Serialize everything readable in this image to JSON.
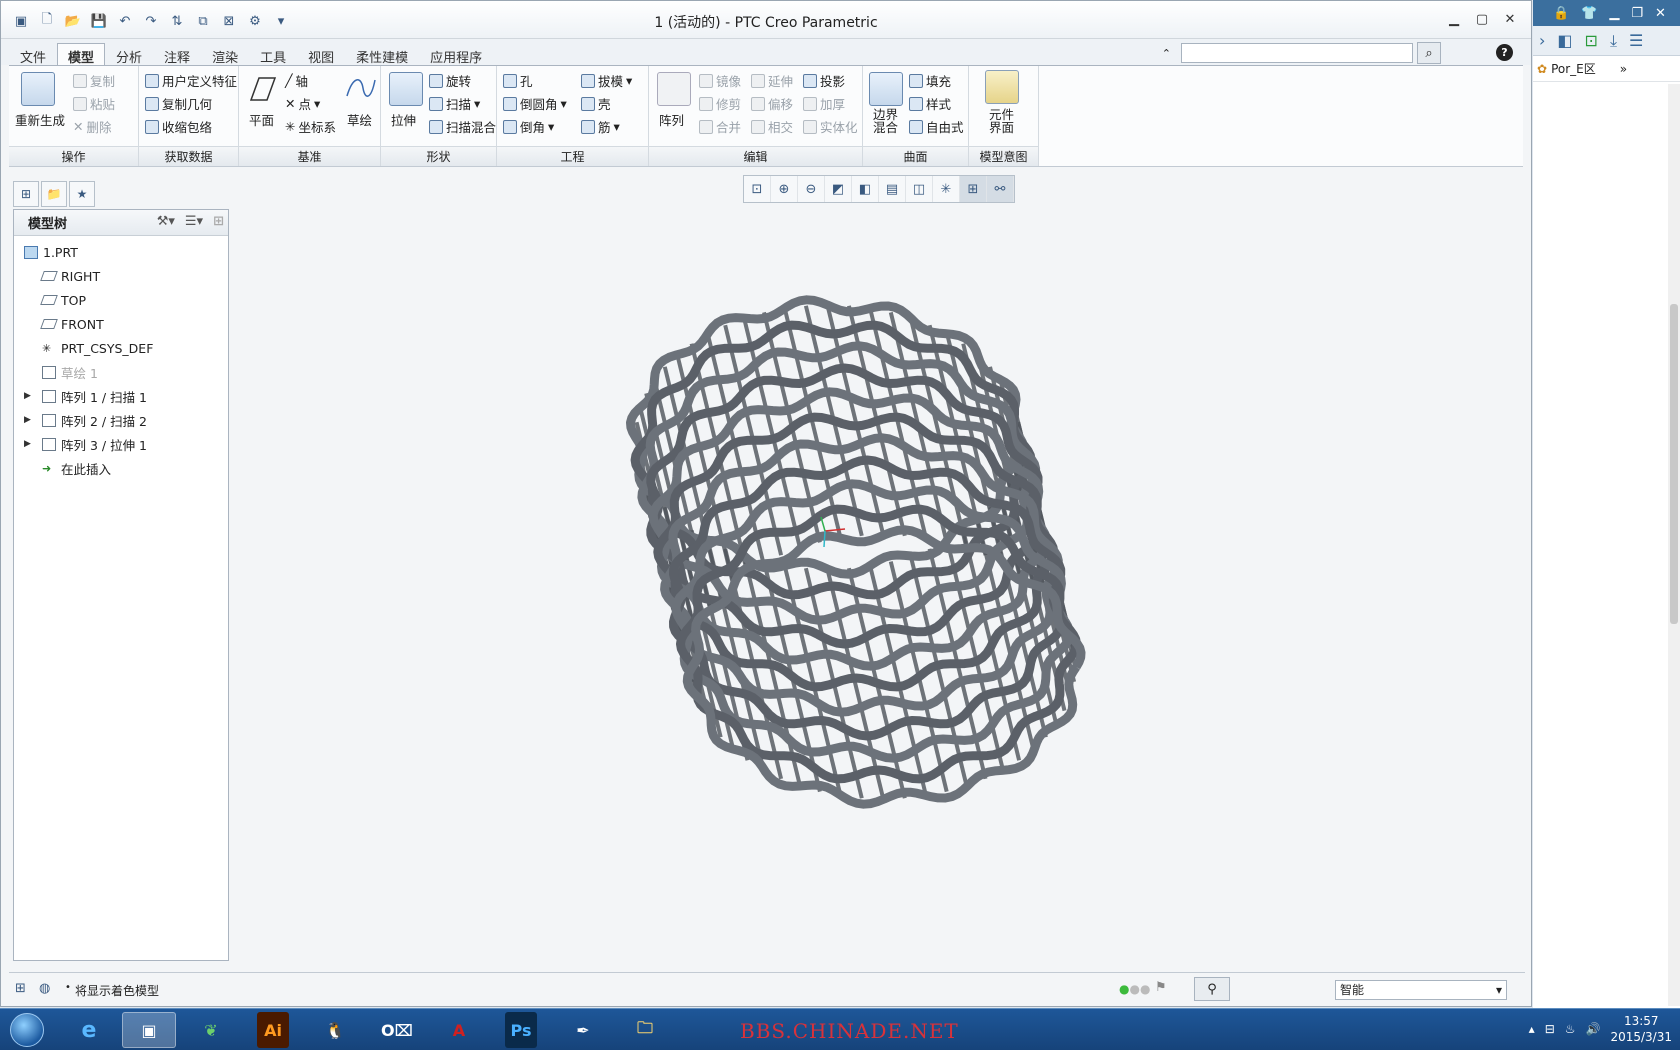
{
  "window": {
    "title": "1 (活动的) - PTC Creo Parametric"
  },
  "tabs": [
    "文件",
    "模型",
    "分析",
    "注释",
    "渲染",
    "工具",
    "视图",
    "柔性建模",
    "应用程序"
  ],
  "ribbon": {
    "ops": {
      "regen": "重新生成",
      "copy": "复制",
      "paste": "粘贴",
      "delete": "删除",
      "footer": "操作"
    },
    "getdata": {
      "udf": "用户定义特征",
      "copygeom": "复制几何",
      "shrink": "收缩包络",
      "footer": "获取数据"
    },
    "datum": {
      "plane": "平面",
      "axis": "轴",
      "point": "点",
      "csys": "坐标系",
      "sketch": "草绘",
      "footer": "基准"
    },
    "shapes": {
      "extrude": "拉伸",
      "revolve": "旋转",
      "sweep": "扫描",
      "sweepblend": "扫描混合",
      "footer": "形状"
    },
    "eng": {
      "hole": "孔",
      "round": "倒圆角",
      "chamfer": "倒角",
      "draft": "拔模",
      "shell": "壳",
      "rib": "筋",
      "footer": "工程"
    },
    "edit": {
      "pattern": "阵列",
      "mirror": "镜像",
      "trim": "修剪",
      "merge": "合并",
      "extend": "延伸",
      "offset": "偏移",
      "intersect": "相交",
      "project": "投影",
      "thicken": "加厚",
      "solidify": "实体化",
      "footer": "编辑"
    },
    "surf": {
      "boundary": "边界\n混合",
      "fill": "填充",
      "style": "样式",
      "freestyle": "自由式",
      "footer": "曲面"
    },
    "intent": {
      "component": "元件\n界面",
      "footer": "模型意图"
    }
  },
  "tree": {
    "header": "模型树",
    "nodes": [
      {
        "label": "1.PRT",
        "type": "part"
      },
      {
        "label": "RIGHT",
        "type": "plane"
      },
      {
        "label": "TOP",
        "type": "plane"
      },
      {
        "label": "FRONT",
        "type": "plane"
      },
      {
        "label": "PRT_CSYS_DEF",
        "type": "csys"
      },
      {
        "label": "草绘 1",
        "type": "sketch",
        "dim": true
      },
      {
        "label": "阵列 1 / 扫描 1",
        "type": "pattern",
        "expand": true
      },
      {
        "label": "阵列 2 / 扫描 2",
        "type": "pattern",
        "expand": true
      },
      {
        "label": "阵列 3 / 拉伸 1",
        "type": "pattern",
        "expand": true
      },
      {
        "label": "在此插入",
        "type": "insert"
      }
    ]
  },
  "status": {
    "message": "将显示着色模型",
    "filter": "智能"
  },
  "side_panel": {
    "label": "Por_E区"
  },
  "taskbar": {
    "watermark": "BBS.CHINADE.NET",
    "time": "13:57",
    "date": "2015/3/31"
  }
}
